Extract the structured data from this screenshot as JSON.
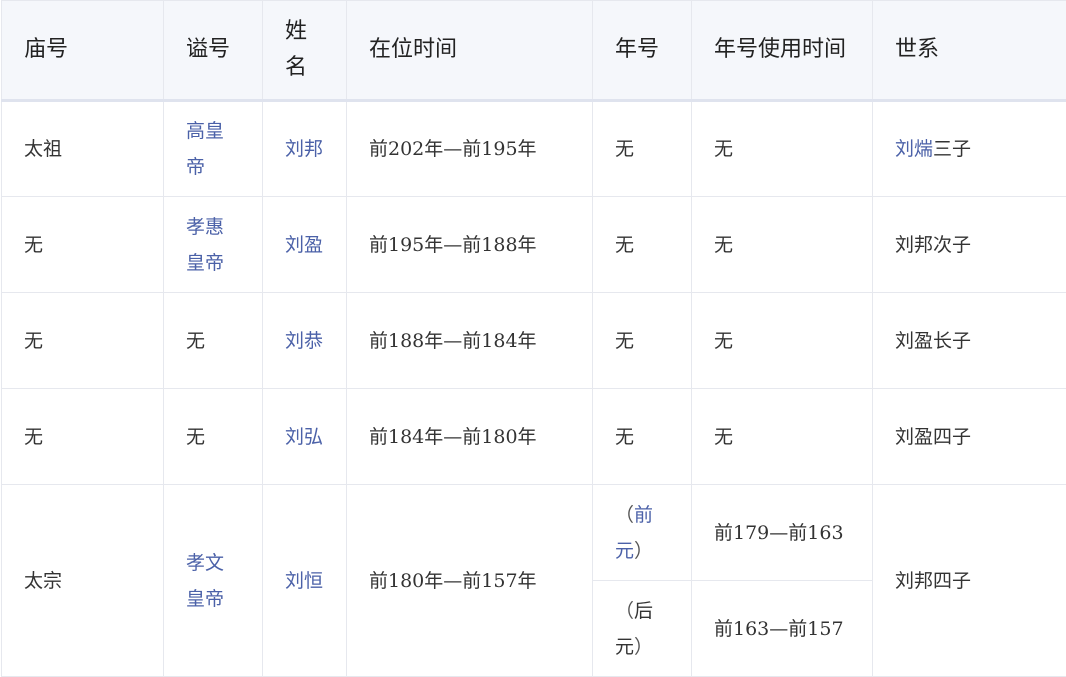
{
  "headers": {
    "temple": "庙号",
    "posthumous": "谥号",
    "name": "姓名",
    "reign": "在位时间",
    "era": "年号",
    "era_period": "年号使用时间",
    "lineage": "世系"
  },
  "rows": [
    {
      "temple": "太祖",
      "posthumous": "高皇帝",
      "name": "刘邦",
      "reign": "前202年—前195年",
      "era": "无",
      "era_period": "无",
      "lineage_link": "刘煓",
      "lineage_rest": "三子"
    },
    {
      "temple": "无",
      "posthumous": "孝惠皇帝",
      "name": "刘盈",
      "reign": "前195年—前188年",
      "era": "无",
      "era_period": "无",
      "lineage": "刘邦次子"
    },
    {
      "temple": "无",
      "posthumous": "无",
      "name": "刘恭",
      "reign": "前188年—前184年",
      "era": "无",
      "era_period": "无",
      "lineage": "刘盈长子"
    },
    {
      "temple": "无",
      "posthumous": "无",
      "name": "刘弘",
      "reign": "前184年—前180年",
      "era": "无",
      "era_period": "无",
      "lineage": "刘盈四子"
    },
    {
      "temple": "太宗",
      "posthumous": "孝文皇帝",
      "name": "刘恒",
      "reign": "前180年—前157年",
      "lineage": "刘邦四子",
      "eras": [
        {
          "open": "（",
          "era": "前元",
          "close": "）",
          "period": "前179—前163"
        },
        {
          "open": "（",
          "era": "后元",
          "close": "）",
          "period": "前163—前157"
        }
      ]
    }
  ]
}
